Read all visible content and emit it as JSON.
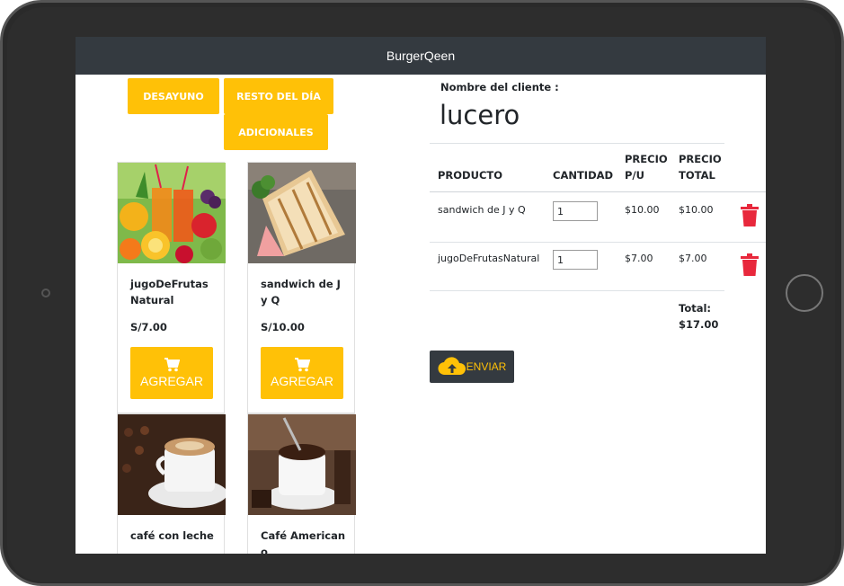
{
  "app": {
    "title": "BurgerQeen"
  },
  "categories": [
    {
      "label": "DESAYUNO"
    },
    {
      "label": "RESTO DEL DÍA"
    },
    {
      "label": "ADICIONALES"
    }
  ],
  "products": [
    {
      "name": "jugoDeFrutasNatural",
      "price": "S/7.00",
      "add_label": "AGREGAR",
      "image": "fruit-juice"
    },
    {
      "name": "sandwich de J y Q",
      "price": "S/10.00",
      "add_label": "AGREGAR",
      "image": "sandwich"
    },
    {
      "name": "café con leche",
      "image": "coffee-with-milk"
    },
    {
      "name": "Café Americano",
      "image": "americano-coffee"
    }
  ],
  "order": {
    "client_label": "Nombre del cliente :",
    "client_name": "lucero",
    "columns": [
      "PRODUCTO",
      "CANTIDAD",
      "PRECIO P/U",
      "PRECIO TOTAL"
    ],
    "rows": [
      {
        "product": "sandwich de J y Q",
        "quantity": "1",
        "unit_price": "$10.00",
        "total_price": "$10.00"
      },
      {
        "product": "jugoDeFrutasNatural",
        "quantity": "1",
        "unit_price": "$7.00",
        "total_price": "$7.00"
      }
    ],
    "total_label": "Total:",
    "total_value": "$17.00",
    "send_label": "ENVIAR"
  },
  "colors": {
    "accent": "#ffc107",
    "navbar": "#343a40",
    "delete": "#e8283c"
  },
  "icons": [
    "cart-icon",
    "trash-icon",
    "cloud-upload-icon"
  ]
}
